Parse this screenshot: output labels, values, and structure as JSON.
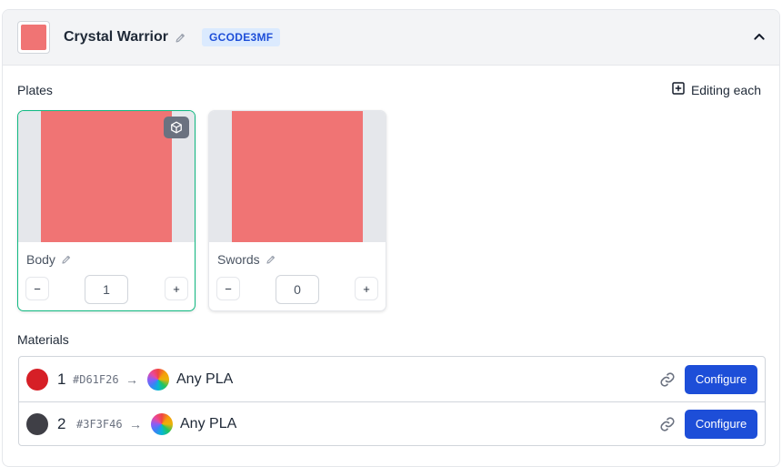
{
  "model": {
    "title": "Crystal Warrior",
    "code": "GCODE3MF",
    "swatch_color": "#f07474",
    "icons": {
      "edit": "pencil-icon",
      "collapse": "chevron-up-icon"
    }
  },
  "plates_section": {
    "label": "Plates",
    "mode_label": "Editing each",
    "mode_icon": "plus-square-icon"
  },
  "plates": [
    {
      "name": "Body",
      "quantity": "1",
      "preview_color": "#f07474",
      "selected": true,
      "decrement": "−",
      "increment": "+"
    },
    {
      "name": "Swords",
      "quantity": "0",
      "preview_color": "#f07474",
      "selected": false,
      "decrement": "−",
      "increment": "+"
    }
  ],
  "materials_section": {
    "label": "Materials"
  },
  "materials": [
    {
      "index": "1",
      "hex": "#D61F26",
      "color": "#d61f26",
      "arrow": "→",
      "target": "Any PLA",
      "action": "Configure"
    },
    {
      "index": "2",
      "hex": "#3F3F46",
      "color": "#3f3f46",
      "arrow": "→",
      "target": "Any PLA",
      "action": "Configure"
    }
  ],
  "colors": {
    "accent": "#1d4ed8",
    "selected_border": "#10b981"
  }
}
